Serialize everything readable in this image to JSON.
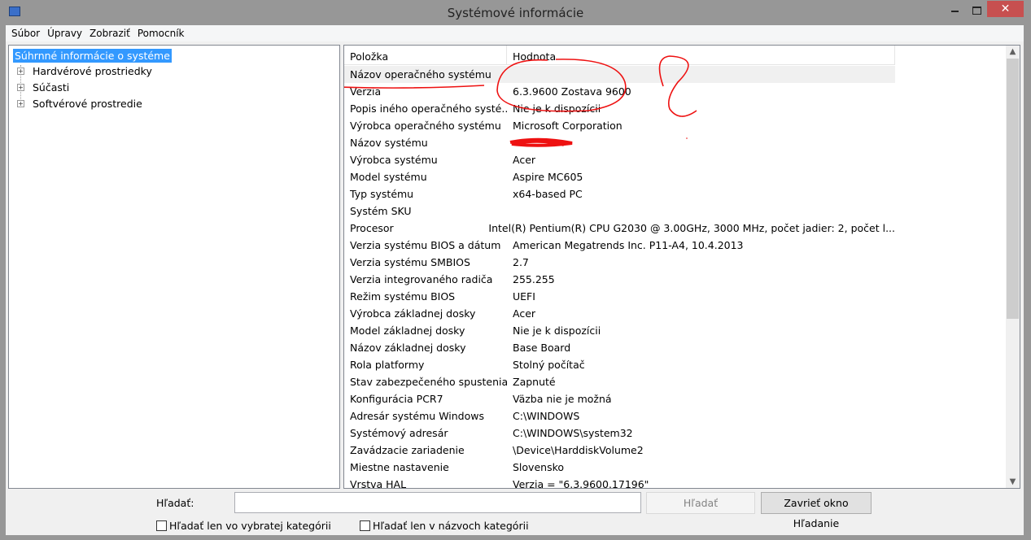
{
  "window": {
    "title": "Systémové informácie",
    "close": "✕"
  },
  "menu": [
    "Súbor",
    "Úpravy",
    "Zobraziť",
    "Pomocník"
  ],
  "tree": {
    "selected": "Súhrnné informácie o systéme",
    "items": [
      "Hardvérové prostriedky",
      "Súčasti",
      "Softvérové prostredie"
    ]
  },
  "table": {
    "headers": [
      "Položka",
      "Hodnota"
    ],
    "rows": [
      [
        "Názov operačného systému",
        ""
      ],
      [
        "Verzia",
        "6.3.9600 Zostava 9600"
      ],
      [
        "Popis iného operačného systé...",
        "Nie je k dispozícii"
      ],
      [
        "Výrobca operačného systému",
        "Microsoft Corporation"
      ],
      [
        "Názov systému",
        ""
      ],
      [
        "Výrobca systému",
        "Acer"
      ],
      [
        "Model systému",
        "Aspire MC605"
      ],
      [
        "Typ systému",
        "x64-based PC"
      ],
      [
        "Systém SKU",
        ""
      ],
      [
        "Procesor",
        "Intel(R) Pentium(R) CPU G2030 @ 3.00GHz, 3000 MHz, počet jadier: 2, počet l..."
      ],
      [
        "Verzia systému BIOS a dátum",
        "American Megatrends Inc. P11-A4, 10.4.2013"
      ],
      [
        "Verzia systému SMBIOS",
        "2.7"
      ],
      [
        "Verzia integrovaného radiča",
        "255.255"
      ],
      [
        "Režim systému BIOS",
        "UEFI"
      ],
      [
        "Výrobca základnej dosky",
        "Acer"
      ],
      [
        "Model základnej dosky",
        "Nie je k dispozícii"
      ],
      [
        "Názov základnej dosky",
        "Base Board"
      ],
      [
        "Rola platformy",
        "Stolný počítač"
      ],
      [
        "Stav zabezpečeného spustenia",
        "Zapnuté"
      ],
      [
        "Konfigurácia PCR7",
        "Väzba nie je možná"
      ],
      [
        "Adresár systému Windows",
        "C:\\WINDOWS"
      ],
      [
        "Systémový adresár",
        "C:\\WINDOWS\\system32"
      ],
      [
        "Zavádzacie zariadenie",
        "\\Device\\HarddiskVolume2"
      ],
      [
        "Miestne nastavenie",
        "Slovensko"
      ],
      [
        "Vrstva HAL",
        "Verzia = \"6.3.9600.17196\""
      ]
    ]
  },
  "search": {
    "label": "Hľadať:",
    "value": "",
    "find_button": "Hľadať",
    "close_button": "Zavrieť okno Hľadanie",
    "check1": "Hľadať len vo vybratej kategórii",
    "check2": "Hľadať len v názvoch kategórii"
  },
  "colors": {
    "accent": "#3399ff",
    "close": "#c75050",
    "ink": "#ee1111"
  }
}
